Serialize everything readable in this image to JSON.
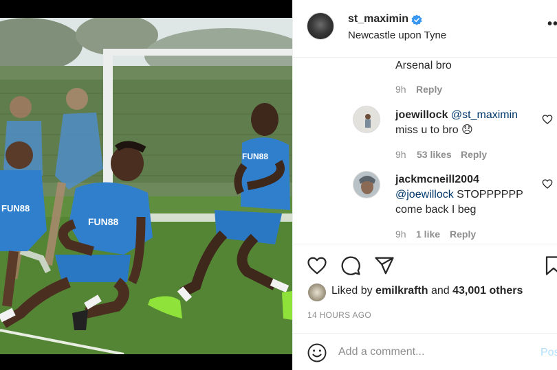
{
  "post": {
    "username": "st_maximin",
    "location": "Newcastle upon Tyne",
    "more_icon": "more-horizontal-icon"
  },
  "photo": {
    "alt": "Newcastle players training on a pitch",
    "shirt_sponsor": "FUN88"
  },
  "comments": [
    {
      "text": "Arsenal bro",
      "time": "9h",
      "reply_label": "Reply"
    },
    {
      "user": "joewillock",
      "mention": "@st_maximin",
      "text": "miss u to bro 😞",
      "time": "9h",
      "likes": "53 likes",
      "reply_label": "Reply"
    },
    {
      "user": "jackmcneill2004",
      "mention": "@joewillock",
      "text_line1": "STOPPPPPP",
      "text_line2": "come back I beg",
      "time": "9h",
      "likes": "1 like",
      "reply_label": "Reply"
    }
  ],
  "likes": {
    "prefix": "Liked by",
    "user": "emilkrafth",
    "middle": "and",
    "others": "43,001 others"
  },
  "timestamp": "14 HOURS AGO",
  "comment_box": {
    "placeholder": "Add a comment...",
    "post_label": "Post"
  },
  "colors": {
    "link": "#00376b",
    "muted": "#8e8e8e",
    "verified": "#3897f0",
    "post_disabled": "#b2dffc"
  }
}
